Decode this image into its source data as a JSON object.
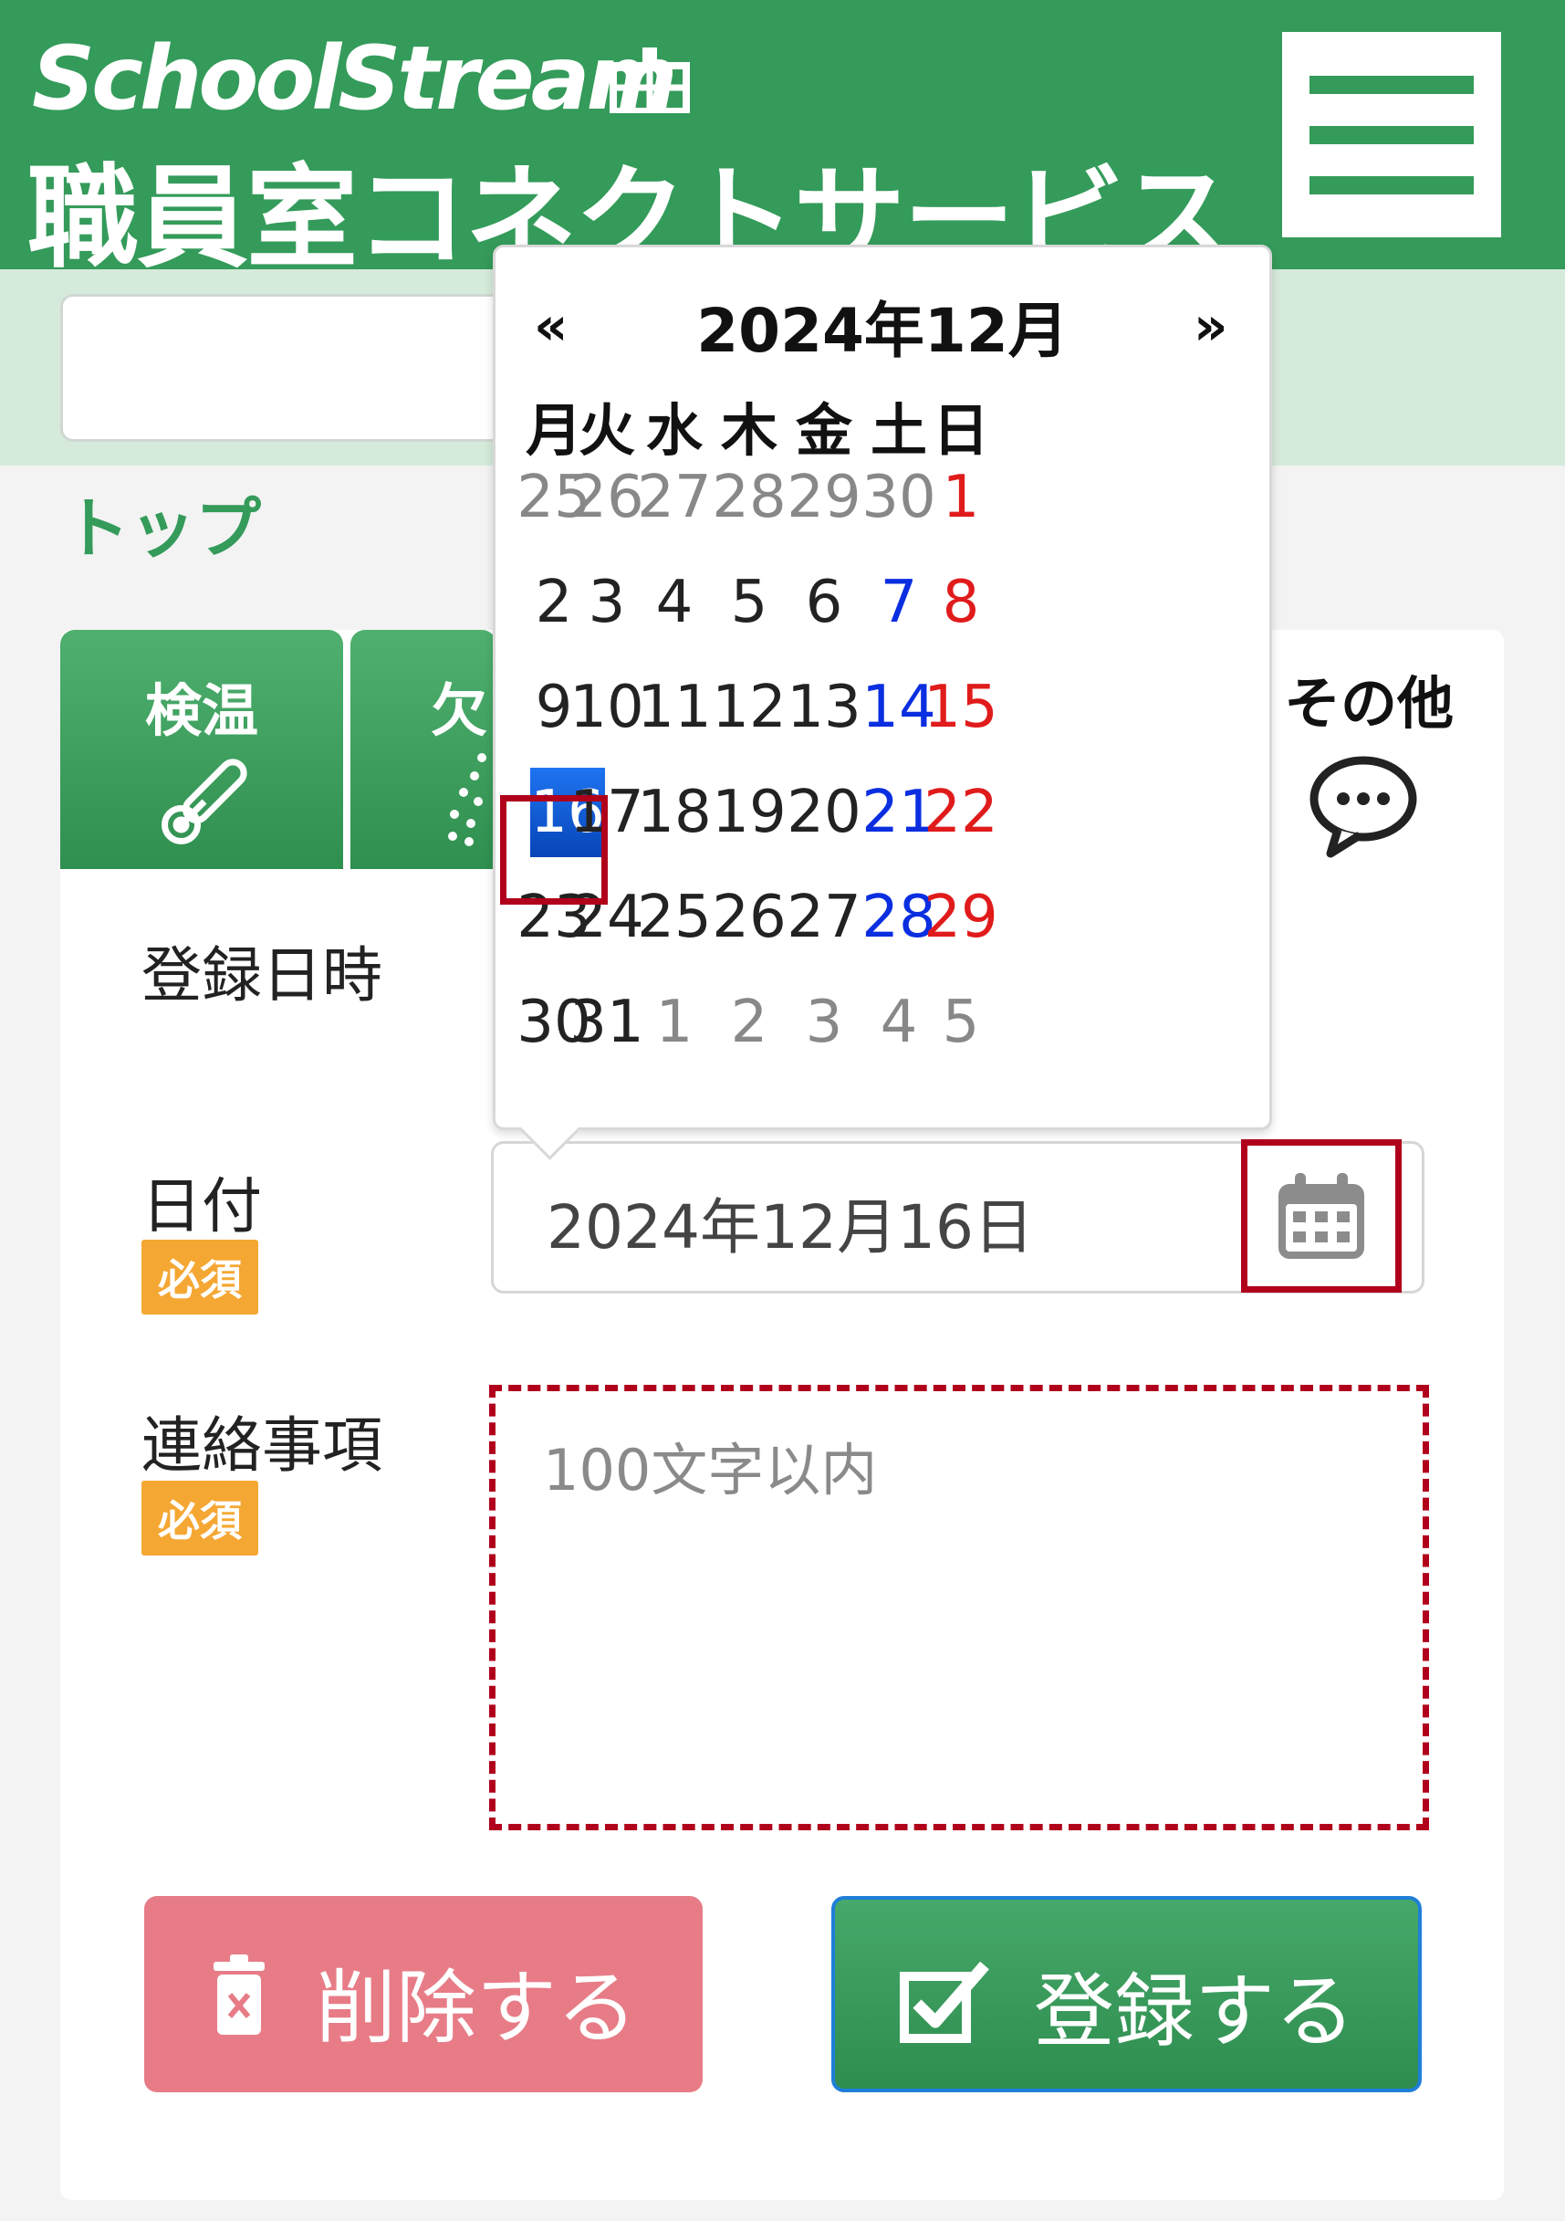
{
  "header": {
    "brand_line1": "SchoolStream",
    "brand_line2": "職員室コネクトサービス",
    "brand_color": "#349b5a"
  },
  "breadcrumb": {
    "top": "トップ"
  },
  "tabs": [
    {
      "label": "検温",
      "icon": "thermometer-icon"
    },
    {
      "label": "欠",
      "icon": "dots-icon"
    },
    {
      "label": "その他",
      "icon": "chat-bubble-icon"
    }
  ],
  "form": {
    "registered_at_label": "登録日時",
    "date_label": "日付",
    "date_required": "必須",
    "date_value": "2024年12月16日",
    "message_label": "連絡事項",
    "message_required": "必須",
    "message_placeholder": "100文字以内"
  },
  "buttons": {
    "delete": "削除する",
    "submit": "登録する"
  },
  "datepicker": {
    "prev": "«",
    "next": "»",
    "title": "2024年12月",
    "weekdays": [
      "月",
      "火",
      "水",
      "木",
      "金",
      "土",
      "日"
    ],
    "selected_day": 16,
    "weeks": [
      [
        {
          "d": "25",
          "k": "muted"
        },
        {
          "d": "26",
          "k": "muted"
        },
        {
          "d": "27",
          "k": "muted"
        },
        {
          "d": "28",
          "k": "muted"
        },
        {
          "d": "29",
          "k": "muted"
        },
        {
          "d": "30",
          "k": "muted"
        },
        {
          "d": "1",
          "k": "sun"
        }
      ],
      [
        {
          "d": "2",
          "k": "normal"
        },
        {
          "d": "3",
          "k": "normal"
        },
        {
          "d": "4",
          "k": "normal"
        },
        {
          "d": "5",
          "k": "normal"
        },
        {
          "d": "6",
          "k": "normal"
        },
        {
          "d": "7",
          "k": "sat"
        },
        {
          "d": "8",
          "k": "sun"
        }
      ],
      [
        {
          "d": "9",
          "k": "normal"
        },
        {
          "d": "10",
          "k": "normal"
        },
        {
          "d": "11",
          "k": "normal"
        },
        {
          "d": "12",
          "k": "normal"
        },
        {
          "d": "13",
          "k": "normal"
        },
        {
          "d": "14",
          "k": "sat"
        },
        {
          "d": "15",
          "k": "sun"
        }
      ],
      [
        {
          "d": "16",
          "k": "selected"
        },
        {
          "d": "17",
          "k": "normal"
        },
        {
          "d": "18",
          "k": "normal"
        },
        {
          "d": "19",
          "k": "normal"
        },
        {
          "d": "20",
          "k": "normal"
        },
        {
          "d": "21",
          "k": "sat"
        },
        {
          "d": "22",
          "k": "sun"
        }
      ],
      [
        {
          "d": "23",
          "k": "normal"
        },
        {
          "d": "24",
          "k": "normal"
        },
        {
          "d": "25",
          "k": "normal"
        },
        {
          "d": "26",
          "k": "normal"
        },
        {
          "d": "27",
          "k": "normal"
        },
        {
          "d": "28",
          "k": "sat"
        },
        {
          "d": "29",
          "k": "sun"
        }
      ],
      [
        {
          "d": "30",
          "k": "normal"
        },
        {
          "d": "31",
          "k": "normal"
        },
        {
          "d": "1",
          "k": "muted"
        },
        {
          "d": "2",
          "k": "muted"
        },
        {
          "d": "3",
          "k": "muted"
        },
        {
          "d": "4",
          "k": "muted"
        },
        {
          "d": "5",
          "k": "muted"
        }
      ]
    ]
  },
  "colors": {
    "accent_green": "#349b5a",
    "required_badge": "#f5a733",
    "delete_button": "#e77c87",
    "highlight_red": "#b0001b",
    "saturday": "#0a2ee0",
    "sunday": "#e01b1b"
  }
}
